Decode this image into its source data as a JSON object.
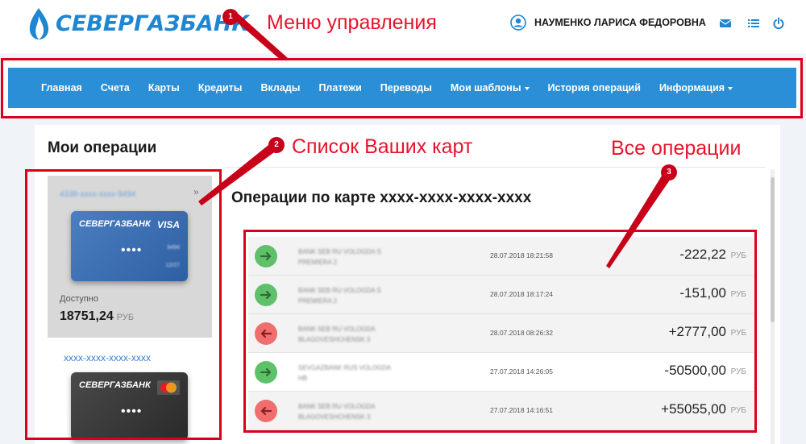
{
  "header": {
    "bank_name": "СЕВЕРГАЗБАНК",
    "user_name": "НАУМЕНКО ЛАРИСА ФЕДОРОВНА",
    "icons": [
      "envelope-icon",
      "list-icon",
      "power-icon"
    ]
  },
  "menu": {
    "items": [
      {
        "label": "Главная",
        "dropdown": false
      },
      {
        "label": "Счета",
        "dropdown": false
      },
      {
        "label": "Карты",
        "dropdown": false
      },
      {
        "label": "Кредиты",
        "dropdown": false
      },
      {
        "label": "Вклады",
        "dropdown": false
      },
      {
        "label": "Платежи",
        "dropdown": false
      },
      {
        "label": "Переводы",
        "dropdown": false
      },
      {
        "label": "Мои шаблоны",
        "dropdown": true
      },
      {
        "label": "История операций",
        "dropdown": false
      },
      {
        "label": "Информация",
        "dropdown": true
      }
    ]
  },
  "left_panel": {
    "title": "Мои операции",
    "cards": [
      {
        "number": "4338-xxxx-xxxx-9494",
        "bank_label": "СЕВЕРГАЗБАНК",
        "brand": "VISA",
        "dots": "••••",
        "masked_a": "9494",
        "masked_b": "12/27",
        "available_label": "Доступно",
        "available_amount": "18751,24",
        "currency": "РУБ"
      },
      {
        "number": "xxxx-xxxx-xxxx-xxxx",
        "bank_label": "СЕВЕРГАЗБАНК",
        "brand": "MasterCard",
        "dots": "••••"
      }
    ]
  },
  "main": {
    "title": "Операции по карте  xxxx-xxxx-xxxx-xxxx",
    "operations": [
      {
        "direction": "in",
        "desc1": "BANK SEB RU VOLOGDA S",
        "desc2": "PREMIERA 2",
        "date": "28.07.2018 18:21:58",
        "amount": "-222,22",
        "currency": "РУБ"
      },
      {
        "direction": "in",
        "desc1": "BANK SEB RU VOLOGDA S",
        "desc2": "PREMIERA 2",
        "date": "28.07.2018 18:17:24",
        "amount": "-151,00",
        "currency": "РУБ"
      },
      {
        "direction": "out",
        "desc1": "BANK SEB RU VOLOGDA",
        "desc2": "BLAGOVESHCHENSK 3",
        "date": "28.07.2018 08:26:32",
        "amount": "+2777,00",
        "currency": "РУБ"
      },
      {
        "direction": "in",
        "desc1": "SEVGAZBANK RUS VOLOGDA",
        "desc2": "HB",
        "date": "27.07.2018 14:26:05",
        "amount": "-50500,00",
        "currency": "РУБ"
      },
      {
        "direction": "out",
        "desc1": "BANK SEB RU VOLOGDA",
        "desc2": "BLAGOVESHCHENSK 3",
        "date": "27.07.2018 14:16:51",
        "amount": "+55055,00",
        "currency": "РУБ"
      }
    ]
  },
  "annotations": [
    {
      "badge": "1",
      "text": "Меню управления"
    },
    {
      "badge": "2",
      "text": "Список Ваших карт"
    },
    {
      "badge": "3",
      "text": "Все операции"
    }
  ],
  "colors": {
    "brand_blue": "#1f86d1",
    "menu_bg": "#2a8fd6",
    "annotation_red": "#d9001b",
    "incoming_green": "#5ec16a",
    "outgoing_red": "#f06e6e"
  }
}
